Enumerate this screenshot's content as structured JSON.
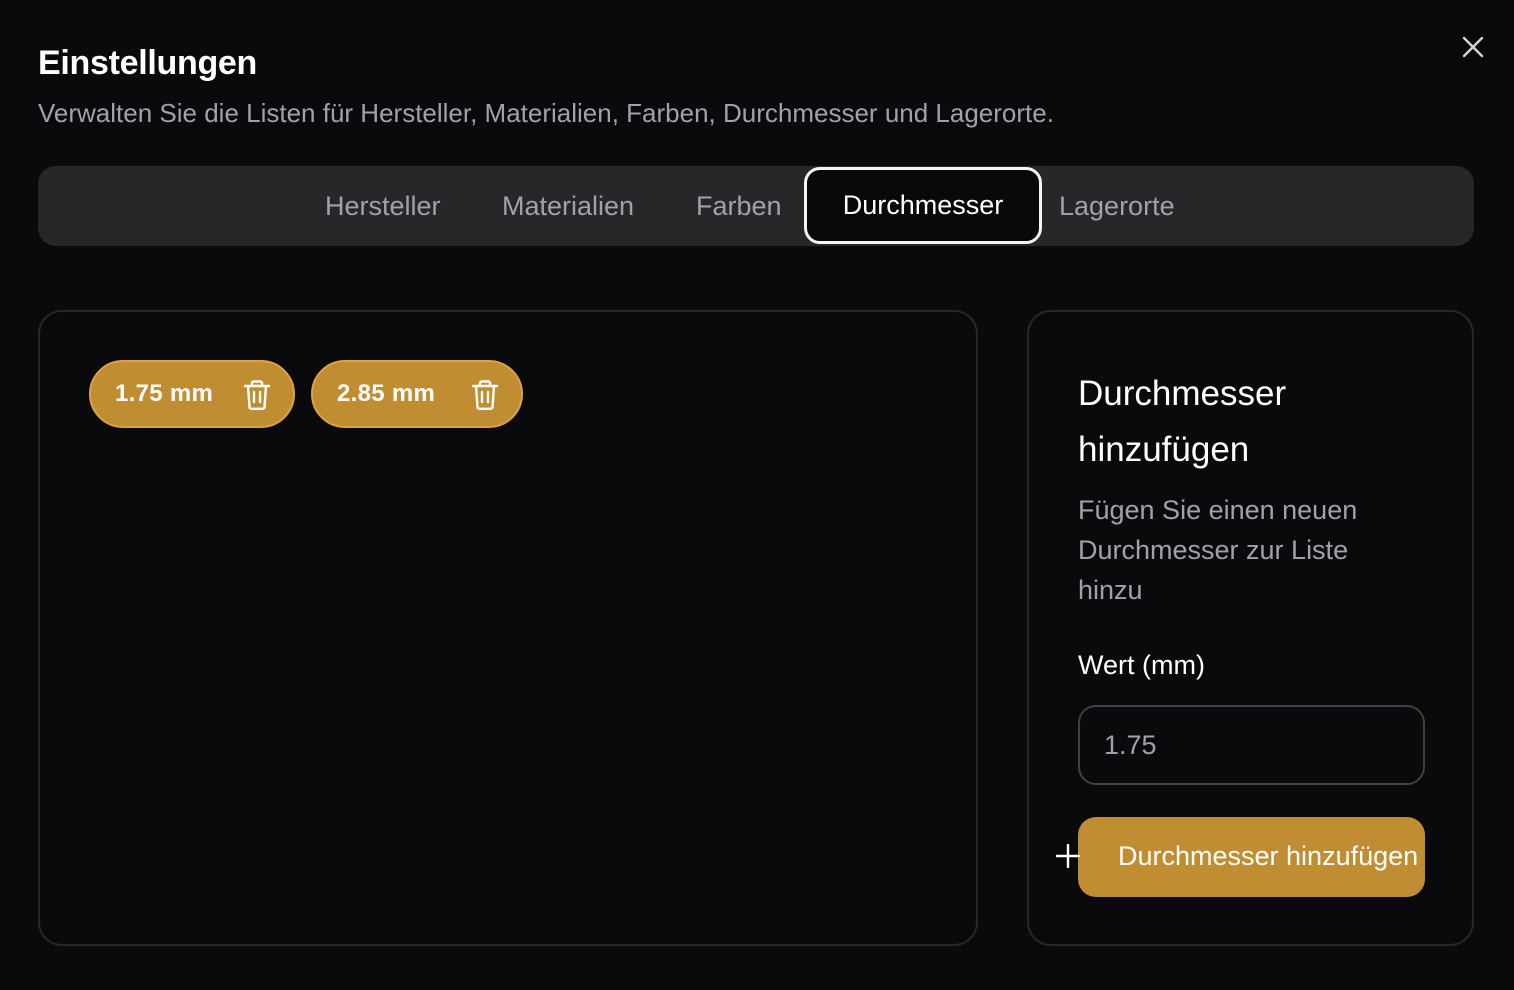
{
  "dialog": {
    "title": "Einstellungen",
    "subtitle": "Verwalten Sie die Listen für Hersteller, Materialien, Farben, Durchmesser und Lagerorte.",
    "close_icon": "close-icon"
  },
  "tabs": [
    {
      "label": "Hersteller",
      "active": false
    },
    {
      "label": "Materialien",
      "active": false
    },
    {
      "label": "Farben",
      "active": false
    },
    {
      "label": "Durchmesser",
      "active": true
    },
    {
      "label": "Lagerorte",
      "active": false
    }
  ],
  "diameters": {
    "items": [
      {
        "label": "1.75 mm",
        "icon": "trash-icon"
      },
      {
        "label": "2.85 mm",
        "icon": "trash-icon"
      }
    ]
  },
  "form": {
    "title": "Durchmesser hinzufügen",
    "description": "Fügen Sie einen neuen Durchmesser zur Liste hinzu",
    "field_label": "Wert (mm)",
    "input_value": "",
    "input_placeholder": "1.75",
    "button_label": "Durchmesser hinzufügen",
    "button_icon": "plus-icon"
  },
  "colors": {
    "background": "#0a0a0c",
    "accent": "#c18d33",
    "tab_bar": "#27272a",
    "muted_text": "#a1a1aa"
  }
}
